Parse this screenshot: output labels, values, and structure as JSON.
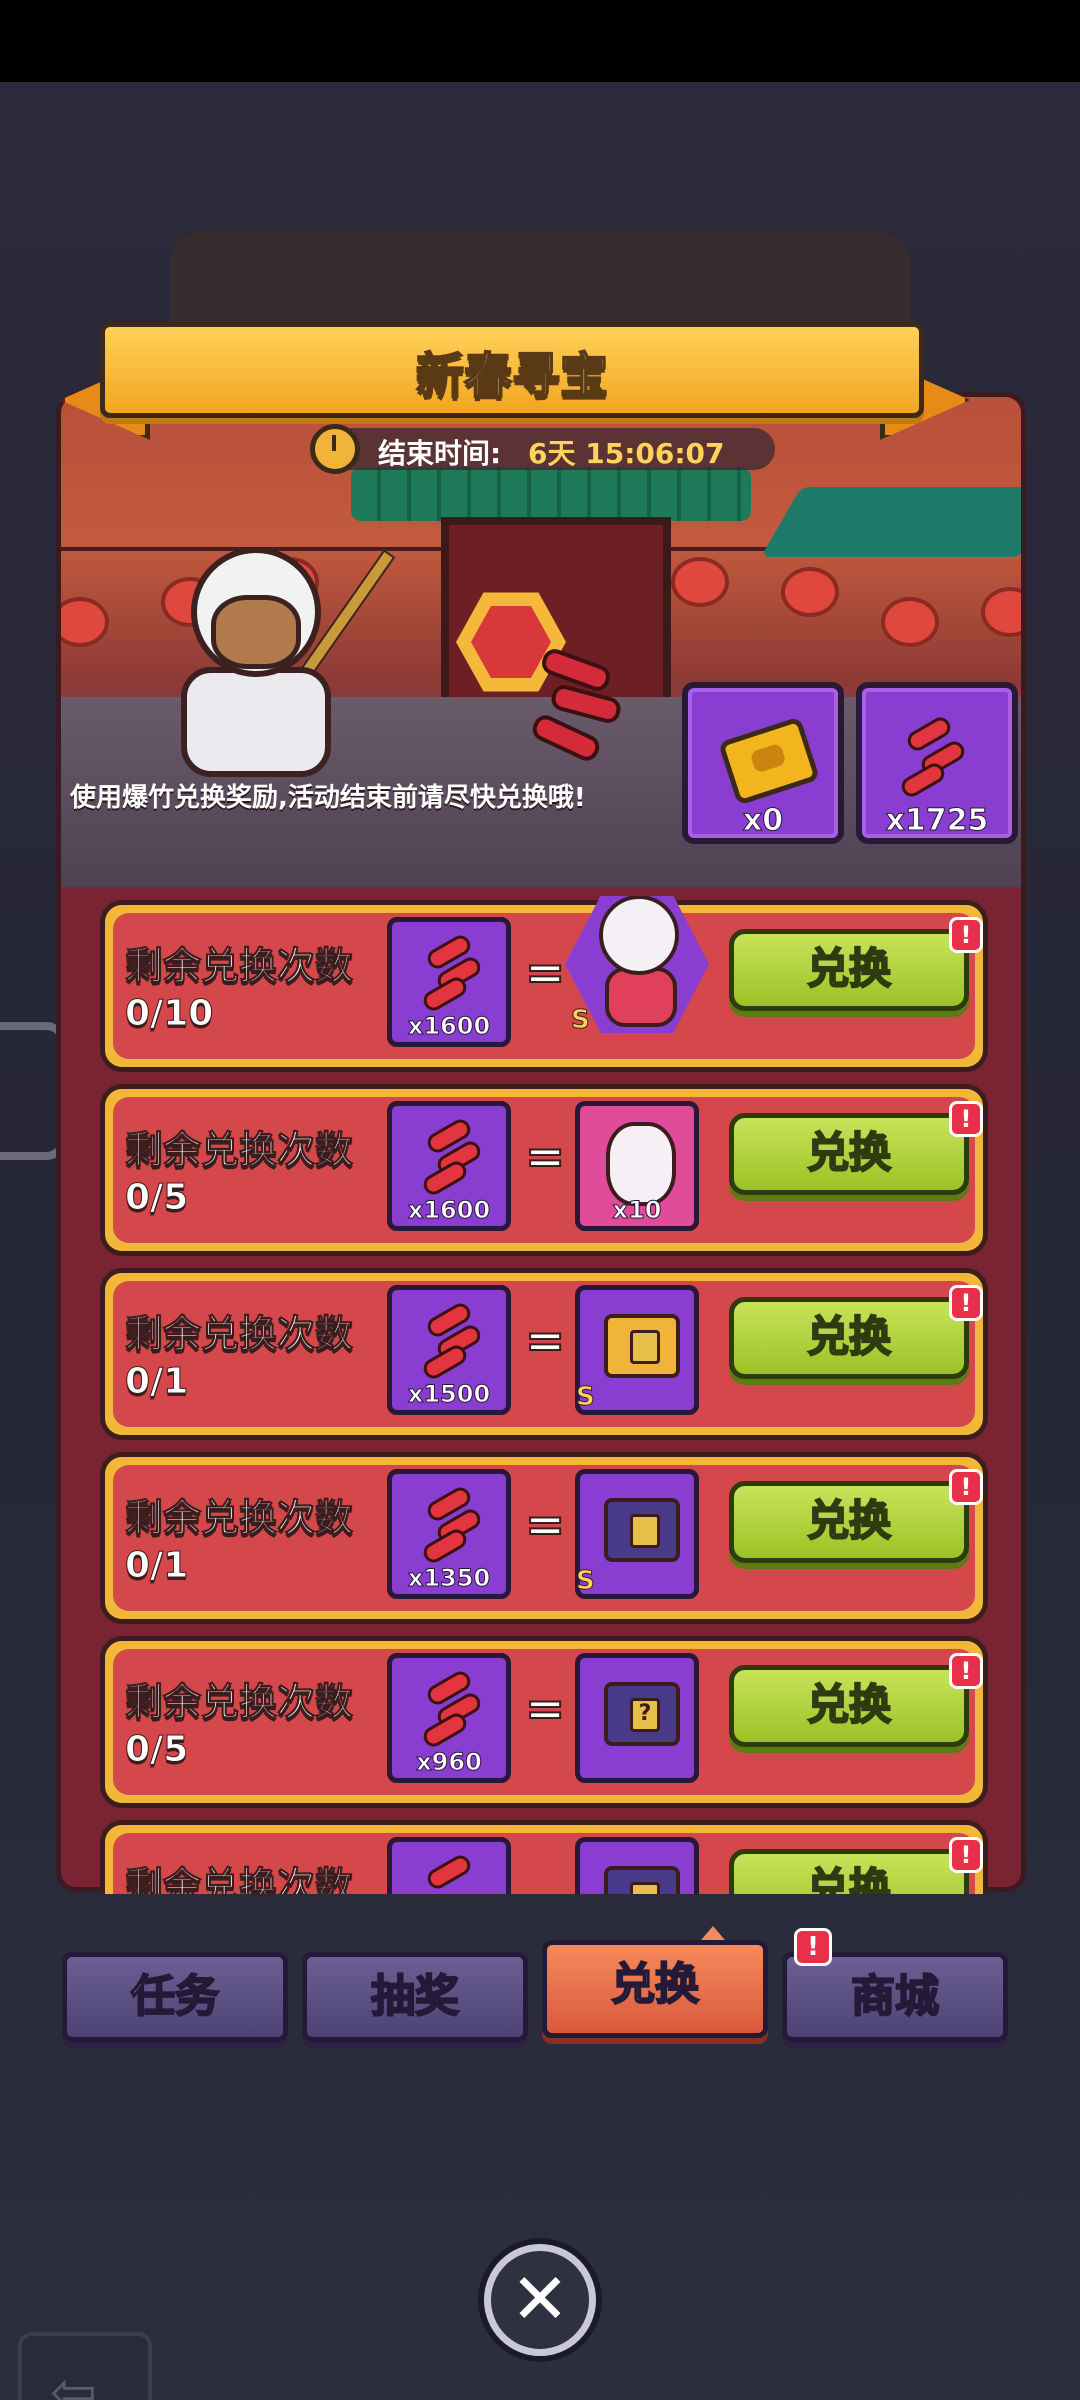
{
  "header": {
    "title": "新春寻宝",
    "timer_label": "结束时间:",
    "timer_value": "6天 15:06:07"
  },
  "description": "使用爆竹兑换奖励,活动结束前请尽快兑换哦!",
  "currencies": [
    {
      "icon": "gold-ticket-icon",
      "amount": "x0"
    },
    {
      "icon": "firecracker-icon",
      "amount": "x1725"
    }
  ],
  "exchange": {
    "row_label": "剩余兑换次数",
    "equals": "=",
    "button_label": "兑换",
    "alert": "!",
    "rows": [
      {
        "remaining": "0/10",
        "cost": "x1600",
        "reward": "hero-icon",
        "reward_grade": "S",
        "reward_qty": ""
      },
      {
        "remaining": "0/5",
        "cost": "x1600",
        "reward": "dragon-pet-icon",
        "reward_grade": "",
        "reward_qty": "x10"
      },
      {
        "remaining": "0/1",
        "cost": "x1500",
        "reward": "gold-chest-icon",
        "reward_grade": "S",
        "reward_qty": ""
      },
      {
        "remaining": "0/1",
        "cost": "x1350",
        "reward": "purple-chest-icon",
        "reward_grade": "S",
        "reward_qty": ""
      },
      {
        "remaining": "0/5",
        "cost": "x960",
        "reward": "mystery-chest-icon",
        "reward_grade": "",
        "reward_qty": ""
      },
      {
        "remaining": "",
        "cost": "",
        "reward": "purple-chest-icon",
        "reward_grade": "",
        "reward_qty": ""
      }
    ]
  },
  "tabs": [
    {
      "label": "任务",
      "active": false
    },
    {
      "label": "抽奖",
      "active": false
    },
    {
      "label": "兑换",
      "active": true
    },
    {
      "label": "商城",
      "active": false
    }
  ],
  "tab_alert": "!",
  "close_icon": "✕",
  "colors": {
    "panel": "#7a2433",
    "row_border": "#f2b739",
    "row_fill": "#d4474a",
    "button": "#9bc325",
    "active_tab": "#d9593f",
    "tab": "#4d4373",
    "item_box": "#8a3ed1"
  }
}
